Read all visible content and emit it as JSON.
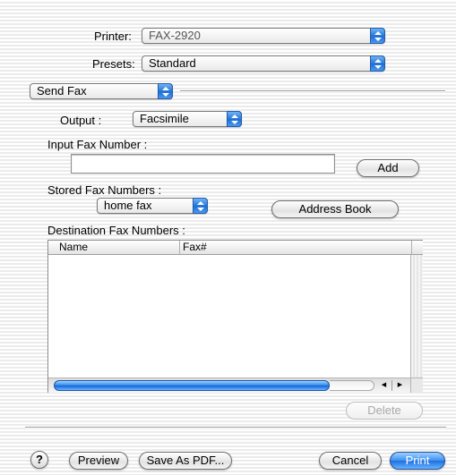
{
  "printer": {
    "label": "Printer:",
    "value": "FAX-2920"
  },
  "presets": {
    "label": "Presets:",
    "value": "Standard"
  },
  "panel": {
    "value": "Send Fax"
  },
  "output": {
    "label": "Output :",
    "value": "Facsimile"
  },
  "input_fax": {
    "label": "Input Fax Number :",
    "value": "",
    "add_label": "Add"
  },
  "stored": {
    "label": "Stored Fax Numbers :",
    "value": "home fax",
    "address_book_label": "Address Book"
  },
  "destination": {
    "label": "Destination Fax Numbers :",
    "columns": [
      "Name",
      "Fax#"
    ],
    "rows": [],
    "delete_label": "Delete"
  },
  "footer": {
    "help_label": "?",
    "preview_label": "Preview",
    "save_pdf_label": "Save As PDF...",
    "cancel_label": "Cancel",
    "print_label": "Print"
  },
  "colors": {
    "accent": "#2d86ea"
  }
}
